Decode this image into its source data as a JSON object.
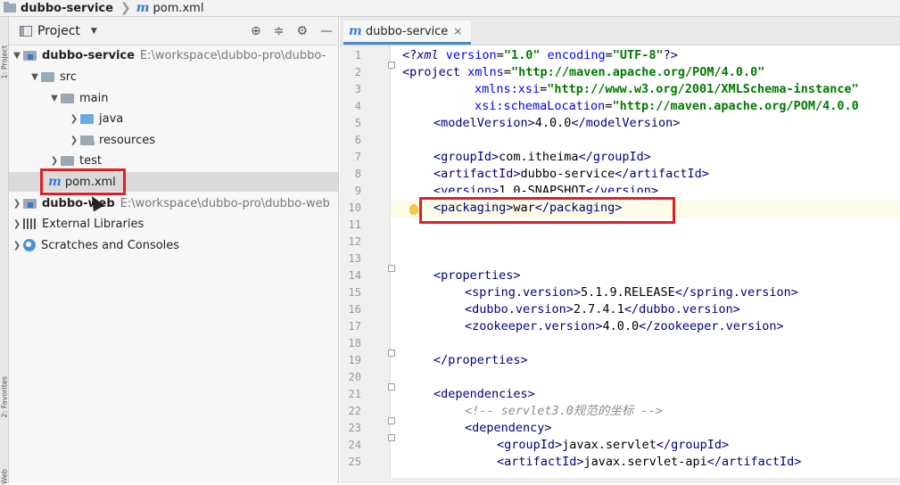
{
  "breadcrumb": {
    "project": "dubbo-service",
    "file": "pom.xml"
  },
  "left_strip": {
    "labels": [
      "1: Project",
      "2: Favorites",
      "Web"
    ]
  },
  "project_panel": {
    "title": "Project",
    "tools": [
      "target-icon",
      "collapse-icon",
      "gear-icon",
      "minimize-icon"
    ],
    "tree": [
      {
        "label": "dubbo-service",
        "path": "E:\\workspace\\dubbo-pro\\dubbo-",
        "bold": true,
        "expanded": true
      },
      {
        "label": "src",
        "expanded": true
      },
      {
        "label": "main",
        "expanded": true
      },
      {
        "label": "java",
        "expanded": false
      },
      {
        "label": "resources",
        "expanded": false
      },
      {
        "label": "test",
        "expanded": false
      },
      {
        "label": "pom.xml"
      },
      {
        "label": "dubbo-web",
        "path": "E:\\workspace\\dubbo-pro\\dubbo-web",
        "bold": true,
        "expanded": false
      },
      {
        "label": "External Libraries",
        "expanded": false
      },
      {
        "label": "Scratches and Consoles",
        "expanded": false
      }
    ]
  },
  "editor": {
    "tab_label": "dubbo-service",
    "tab_close": "×",
    "line_numbers": [
      "1",
      "2",
      "3",
      "4",
      "5",
      "6",
      "7",
      "8",
      "9",
      "10",
      "11",
      "12",
      "13",
      "14",
      "15",
      "16",
      "17",
      "18",
      "19",
      "20",
      "21",
      "22",
      "23",
      "24",
      "25"
    ],
    "lines": {
      "l1": {
        "open": "<?",
        "kw": "xml",
        "a1": " version",
        "eq1": "=",
        "v1": "\"1.0\"",
        "a2": " encoding",
        "eq2": "=",
        "v2": "\"UTF-8\"",
        "close": "?>"
      },
      "l2": {
        "open": "<project",
        "a": " xmlns",
        "eq": "=",
        "v": "\"http://maven.apache.org/POM/4.0.0\""
      },
      "l3": {
        "a": "xmlns:xsi",
        "eq": "=",
        "v": "\"http://www.w3.org/2001/XMLSchema-instance\""
      },
      "l4": {
        "a": "xsi:schemaLocation",
        "eq": "=",
        "v": "\"http://maven.apache.org/POM/4.0.0"
      },
      "l5": {
        "o": "<modelVersion>",
        "t": "4.0.0",
        "c": "</modelVersion>"
      },
      "l7": {
        "o": "<groupId>",
        "t": "com.itheima",
        "c": "</groupId>"
      },
      "l8": {
        "o": "<artifactId>",
        "t": "dubbo-service",
        "c": "</artifactId>"
      },
      "l9": {
        "o": "<version>",
        "t": "1.0-SNAPSHOT",
        "c": "</version>"
      },
      "l10": {
        "o": "<packaging>",
        "t": "war",
        "c": "</packaging>"
      },
      "l14": {
        "o": "<properties>"
      },
      "l15": {
        "o": "<spring.version>",
        "t": "5.1.9.RELEASE",
        "c": "</spring.version>"
      },
      "l16": {
        "o": "<dubbo.version>",
        "t": "2.7.4.1",
        "c": "</dubbo.version>"
      },
      "l17": {
        "o": "<zookeeper.version>",
        "t": "4.0.0",
        "c": "</zookeeper.version>"
      },
      "l19": {
        "c": "</properties>"
      },
      "l21": {
        "o": "<dependencies>"
      },
      "l22": {
        "cmt": "<!-- servlet3.0规范的坐标 -->"
      },
      "l23": {
        "o": "<dependency>"
      },
      "l24": {
        "o": "<groupId>",
        "t": "javax.servlet",
        "c": "</groupId>"
      },
      "l25": {
        "o": "<artifactId>",
        "t": "javax.servlet-api",
        "c": "</artifactId>"
      }
    }
  },
  "colors": {
    "highlight_box": "#e01e24",
    "tag": "#000080",
    "attr_value": "#007a00",
    "current_line": "#fcfbe6"
  }
}
